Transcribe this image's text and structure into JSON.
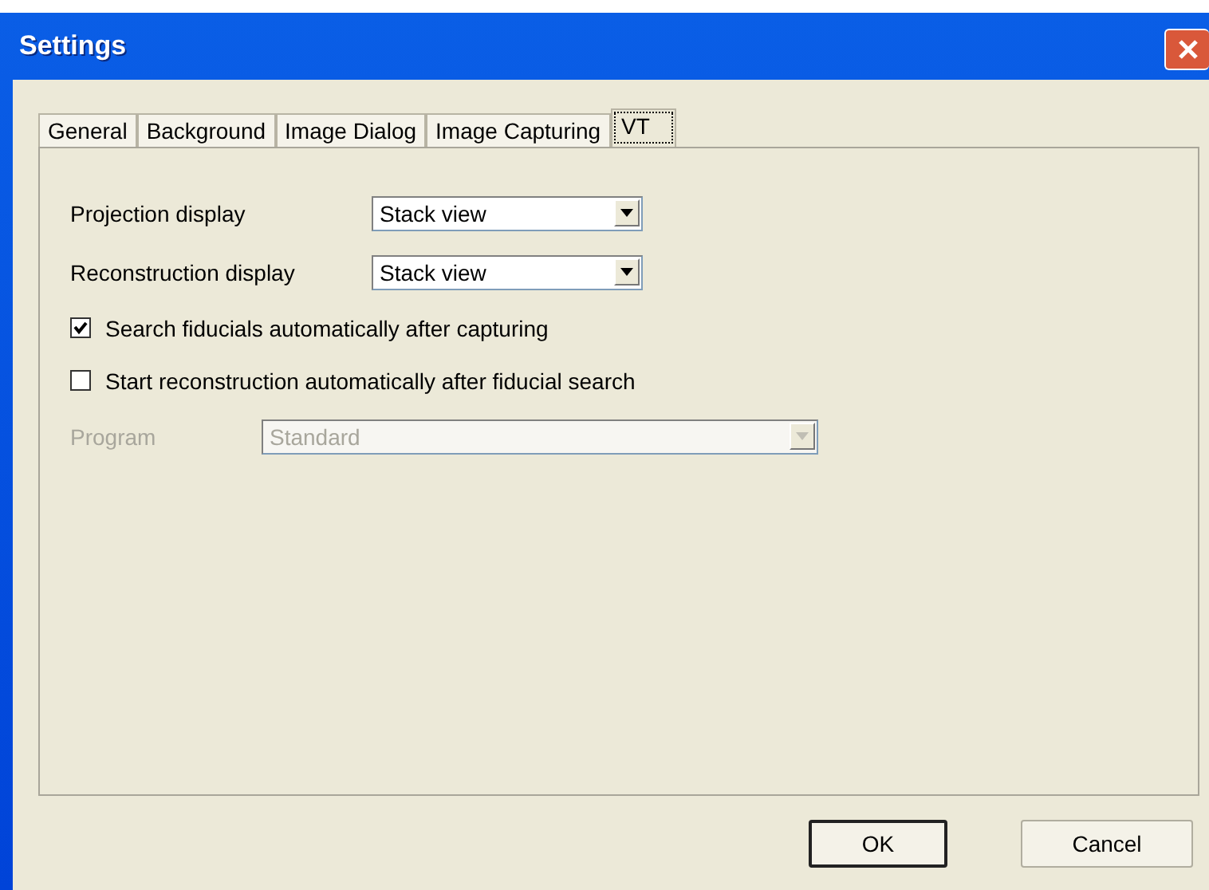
{
  "window": {
    "title": "Settings"
  },
  "tabs": [
    {
      "label": "General",
      "selected": false
    },
    {
      "label": "Background",
      "selected": false
    },
    {
      "label": "Image Dialog",
      "selected": false
    },
    {
      "label": "Image Capturing",
      "selected": false
    },
    {
      "label": "VT",
      "selected": true
    }
  ],
  "rows": [
    {
      "kind": "dropdown",
      "label": "Projection display",
      "value": "Stack view",
      "disabled": false
    },
    {
      "kind": "dropdown",
      "label": "Reconstruction display",
      "value": "Stack view",
      "disabled": false
    },
    {
      "kind": "checkbox",
      "label": "Search fiducials automatically after capturing",
      "checked": true
    },
    {
      "kind": "checkbox",
      "label": "Start reconstruction automatically after fiducial search",
      "checked": false
    },
    {
      "kind": "dropdown",
      "label": "Program",
      "value": "Standard",
      "disabled": true
    }
  ],
  "buttons": [
    {
      "label": "OK",
      "default": true
    },
    {
      "label": "Cancel",
      "default": false
    }
  ]
}
